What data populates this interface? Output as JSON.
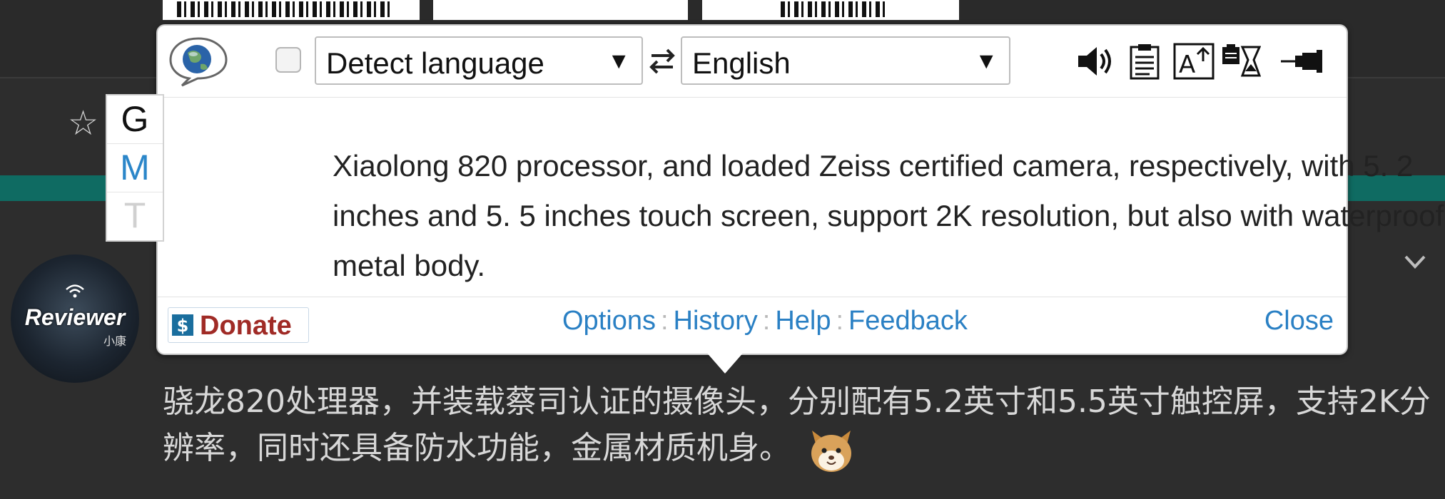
{
  "popup": {
    "source_language": "Detect language",
    "target_language": "English",
    "engine_tabs": [
      "G",
      "M",
      "T"
    ],
    "translation": "Xiaolong 820 processor, and loaded Zeiss certified camera, respectively, with 5. 2 inches and 5. 5 inches touch screen, support 2K resolution, but also with waterproof, metal body.",
    "donate_label": "Donate",
    "links": {
      "options": "Options",
      "history": "History",
      "help": "Help",
      "feedback": "Feedback"
    },
    "link_separator": ":",
    "close_label": "Close",
    "toolbar_icons": [
      "speaker-icon",
      "clipboard-icon",
      "font-size-icon",
      "paste-timer-icon",
      "pin-icon"
    ]
  },
  "background": {
    "avatar_text": "Reviewer",
    "avatar_subtext": "小康",
    "post_text": "骁龙820处理器，并装载蔡司认证的摄像头，分别配有5.2英寸和5.5英寸触控屏，支持2K分辨率，同时还具备防水功能，金属材质机身。"
  },
  "colors": {
    "page_bg": "#2d2d2d",
    "teal_band": "#0f6b62",
    "link_blue": "#2a80c4",
    "donate_red": "#a02b26"
  }
}
